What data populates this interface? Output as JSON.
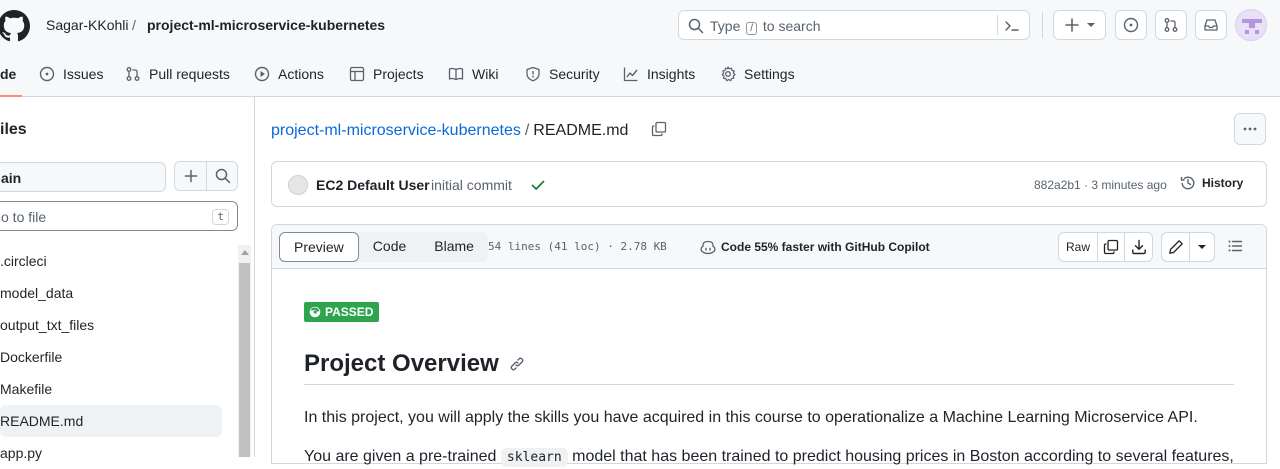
{
  "header": {
    "owner": "Sagar-KKohli",
    "separator": "/",
    "repo": "project-ml-microservice-kubernetes",
    "search_prefix": "Type",
    "search_key": "/",
    "search_suffix": "to search",
    "new_button": "+"
  },
  "nav": {
    "code": "de",
    "issues": "Issues",
    "pull_requests": "Pull requests",
    "actions": "Actions",
    "projects": "Projects",
    "wiki": "Wiki",
    "security": "Security",
    "insights": "Insights",
    "settings": "Settings",
    "active_color": "#fd8c73"
  },
  "sidebar": {
    "title": "iles",
    "branch": "ain",
    "goto_placeholder": "o to file",
    "goto_key": "t",
    "files": [
      {
        "name": ".circleci",
        "selected": false
      },
      {
        "name": "model_data",
        "selected": false
      },
      {
        "name": "output_txt_files",
        "selected": false
      },
      {
        "name": "Dockerfile",
        "selected": false
      },
      {
        "name": "Makefile",
        "selected": false
      },
      {
        "name": "README.md",
        "selected": true
      },
      {
        "name": "app.py",
        "selected": false
      }
    ]
  },
  "main": {
    "path_repo": "project-ml-microservice-kubernetes",
    "path_sep": "/",
    "path_file": "README.md",
    "commit": {
      "author": "EC2 Default User",
      "message": "initial commit",
      "sha_time": "882a2b1 · 3 minutes ago",
      "history": "History"
    },
    "file_header": {
      "tabs": [
        "Preview",
        "Code",
        "Blame"
      ],
      "active_tab": "Preview",
      "stats": "54 lines (41 loc) · 2.78 KB",
      "copilot": "Code 55% faster with GitHub Copilot",
      "raw": "Raw"
    },
    "readme": {
      "badge": "PASSED",
      "badge_color": "#2ea44f",
      "heading": "Project Overview",
      "para1": "In this project, you will apply the skills you have acquired in this course to operationalize a Machine Learning Microservice API.",
      "para2_start": "You are given a pre-trained",
      "para2_code": "sklearn",
      "para2_end": "model that has been trained to predict housing prices in Boston according to several features,"
    }
  },
  "colors": {
    "link": "#0969da",
    "success": "#1a7f37"
  }
}
